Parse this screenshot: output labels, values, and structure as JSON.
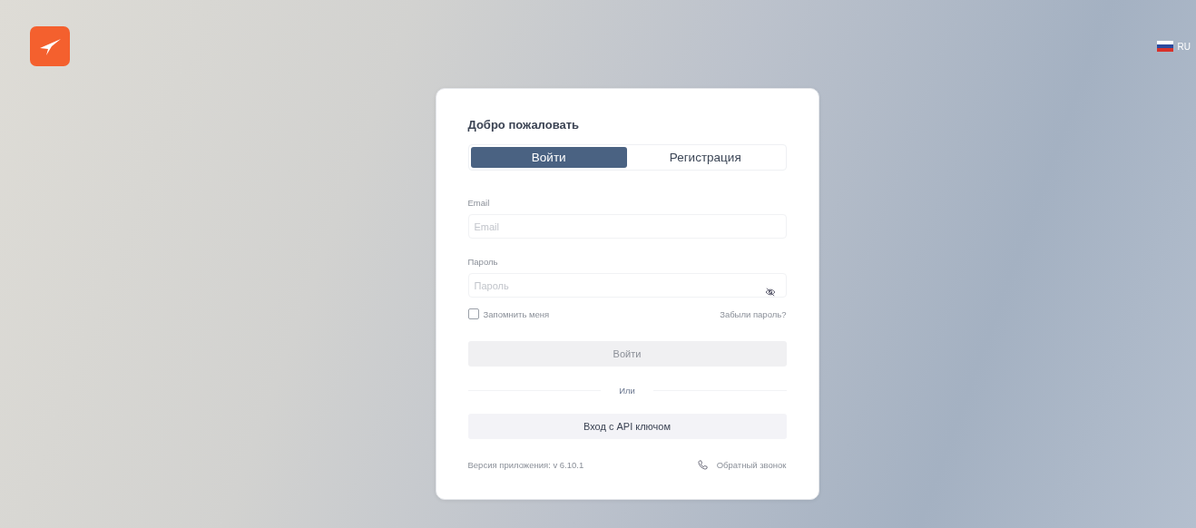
{
  "language": {
    "code": "RU"
  },
  "card": {
    "title": "Добро пожаловать",
    "tabs": [
      {
        "label": "Войти",
        "selected": true
      },
      {
        "label": "Регистрация",
        "selected": false
      }
    ],
    "fields": [
      {
        "label": "Email",
        "placeholder": "Email",
        "kind": "text"
      },
      {
        "label": "Пароль",
        "placeholder": "Пароль",
        "kind": "password"
      }
    ],
    "remember": {
      "label": "Запомнить меня",
      "checked": false
    },
    "forgot_link": "Забыли пароль?",
    "submit_button": {
      "label": "Войти",
      "disabled": true
    },
    "divider_text": "Или",
    "api_button": "Вход с API ключом",
    "version": "Версия приложения: v 6.10.1",
    "callback_link": "Обратный звонок"
  }
}
